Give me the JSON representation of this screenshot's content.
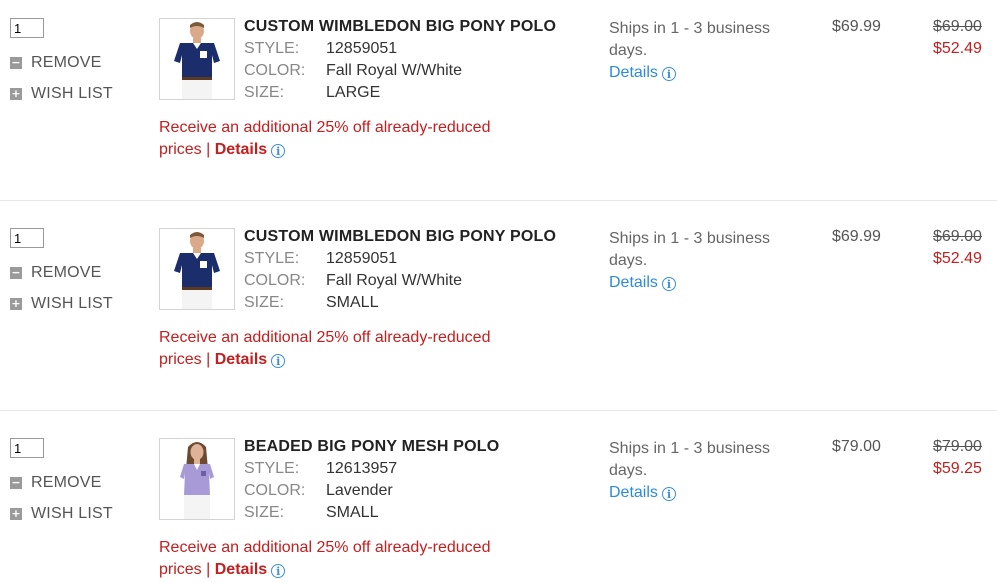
{
  "actions": {
    "remove_label": "REMOVE",
    "wishlist_label": "WISH LIST"
  },
  "labels": {
    "style": "STYLE:",
    "color": "COLOR:",
    "size": "SIZE:"
  },
  "items": [
    {
      "qty": "1",
      "name": "CUSTOM WIMBLEDON BIG PONY POLO",
      "style": "12859051",
      "color": "Fall Royal W/White",
      "size": "LARGE",
      "promo_text": "Receive an additional 25% off already-reduced prices",
      "promo_sep": " | ",
      "promo_link": "Details",
      "ship_text": "Ships in 1 - 3 business days.",
      "ship_link": "Details",
      "price": "$69.99",
      "orig_price": "$69.00",
      "sale_price": "$52.49",
      "thumb_icon": "royal-polo-man-icon",
      "shirt_color": "#1b2d6b"
    },
    {
      "qty": "1",
      "name": "CUSTOM WIMBLEDON BIG PONY POLO",
      "style": "12859051",
      "color": "Fall Royal W/White",
      "size": "SMALL",
      "promo_text": "Receive an additional 25% off already-reduced prices",
      "promo_sep": " | ",
      "promo_link": "Details",
      "ship_text": "Ships in 1 - 3 business days.",
      "ship_link": "Details",
      "price": "$69.99",
      "orig_price": "$69.00",
      "sale_price": "$52.49",
      "thumb_icon": "royal-polo-man-icon",
      "shirt_color": "#1b2d6b"
    },
    {
      "qty": "1",
      "name": "BEADED BIG PONY MESH POLO",
      "style": "12613957",
      "color": "Lavender",
      "size": "SMALL",
      "promo_text": "Receive an additional 25% off already-reduced prices",
      "promo_sep": " | ",
      "promo_link": "Details",
      "ship_text": "Ships in 1 - 3 business days.",
      "ship_link": "Details",
      "price": "$79.00",
      "orig_price": "$79.00",
      "sale_price": "$59.25",
      "thumb_icon": "lavender-polo-woman-icon",
      "shirt_color": "#a79ad6"
    }
  ],
  "colors": {
    "promo_red": "#c41e1e",
    "link_blue": "#2c8bd8",
    "sale_red": "#c41e1e"
  }
}
